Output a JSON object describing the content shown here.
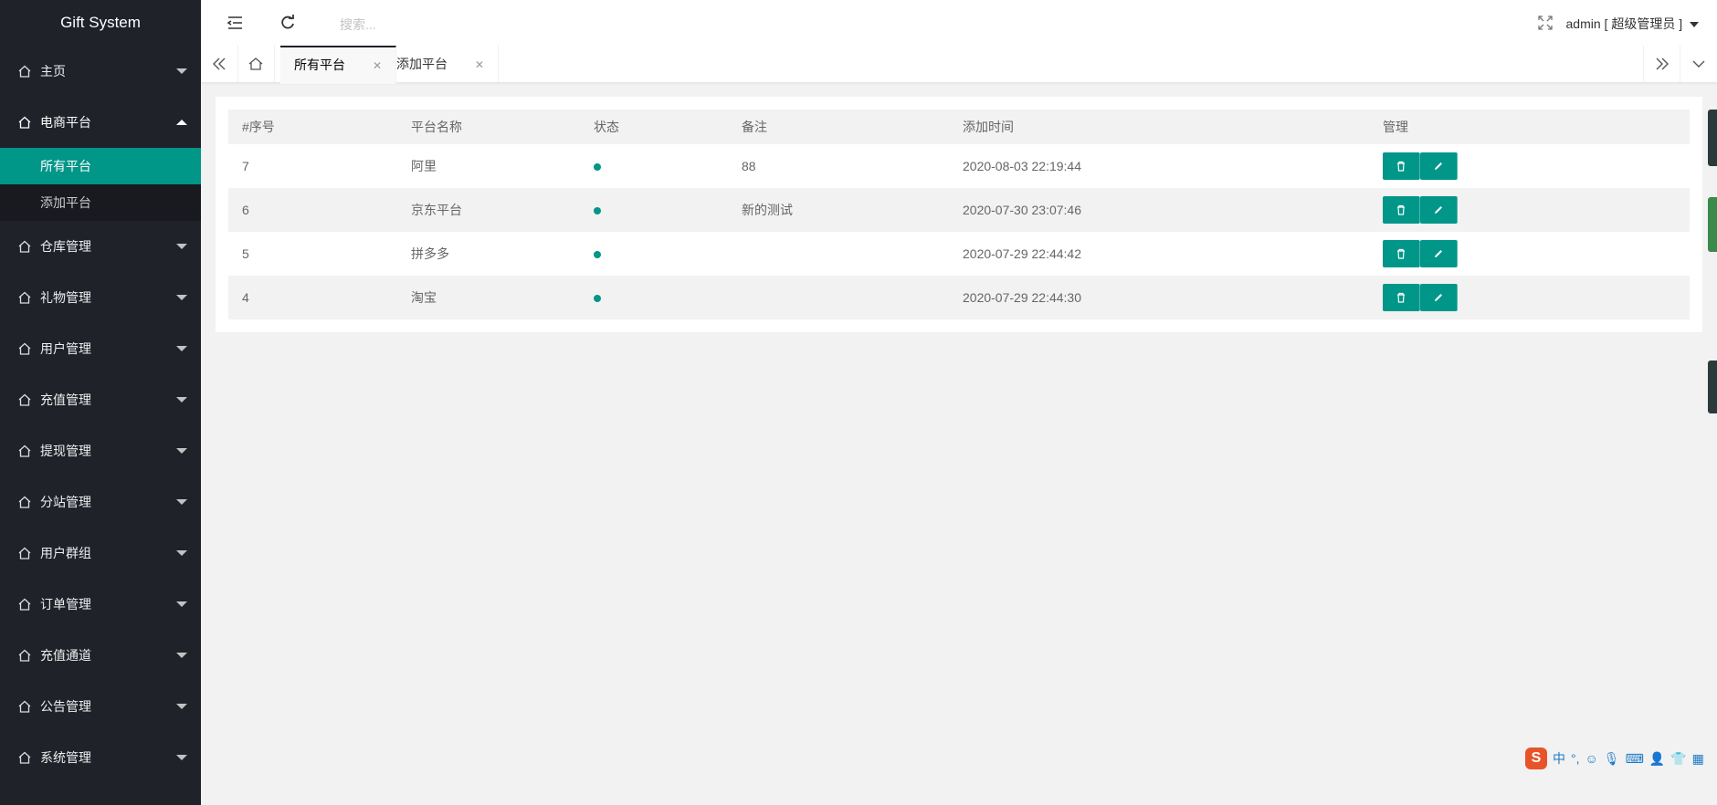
{
  "app": {
    "title": "Gift System"
  },
  "sidebar": {
    "items": [
      {
        "label": "主页",
        "expanded": false
      },
      {
        "label": "电商平台",
        "expanded": true,
        "children": [
          {
            "label": "所有平台",
            "active": true
          },
          {
            "label": "添加平台",
            "active": false
          }
        ]
      },
      {
        "label": "仓库管理",
        "expanded": false
      },
      {
        "label": "礼物管理",
        "expanded": false
      },
      {
        "label": "用户管理",
        "expanded": false
      },
      {
        "label": "充值管理",
        "expanded": false
      },
      {
        "label": "提现管理",
        "expanded": false
      },
      {
        "label": "分站管理",
        "expanded": false
      },
      {
        "label": "用户群组",
        "expanded": false
      },
      {
        "label": "订单管理",
        "expanded": false
      },
      {
        "label": "充值通道",
        "expanded": false
      },
      {
        "label": "公告管理",
        "expanded": false
      },
      {
        "label": "系统管理",
        "expanded": false
      }
    ]
  },
  "header": {
    "search_placeholder": "搜索...",
    "user_label": "admin [ 超级管理员 ]"
  },
  "tabs": [
    {
      "label": "所有平台",
      "active": true
    },
    {
      "label": "添加平台",
      "active": false
    }
  ],
  "table": {
    "columns": [
      "#序号",
      "平台名称",
      "状态",
      "备注",
      "添加时间",
      "管理"
    ],
    "rows": [
      {
        "id": "7",
        "name": "阿里",
        "status": "active",
        "note": "88",
        "time": "2020-08-03 22:19:44"
      },
      {
        "id": "6",
        "name": "京东平台",
        "status": "active",
        "note": "新的测试",
        "time": "2020-07-30 23:07:46"
      },
      {
        "id": "5",
        "name": "拼多多",
        "status": "active",
        "note": "",
        "time": "2020-07-29 22:44:42"
      },
      {
        "id": "4",
        "name": "淘宝",
        "status": "active",
        "note": "",
        "time": "2020-07-29 22:44:30"
      }
    ]
  },
  "ime": {
    "logo": "S",
    "lang": "中",
    "punct": "°,"
  },
  "colors": {
    "sidebar_bg": "#20222a",
    "accent": "#009688"
  }
}
